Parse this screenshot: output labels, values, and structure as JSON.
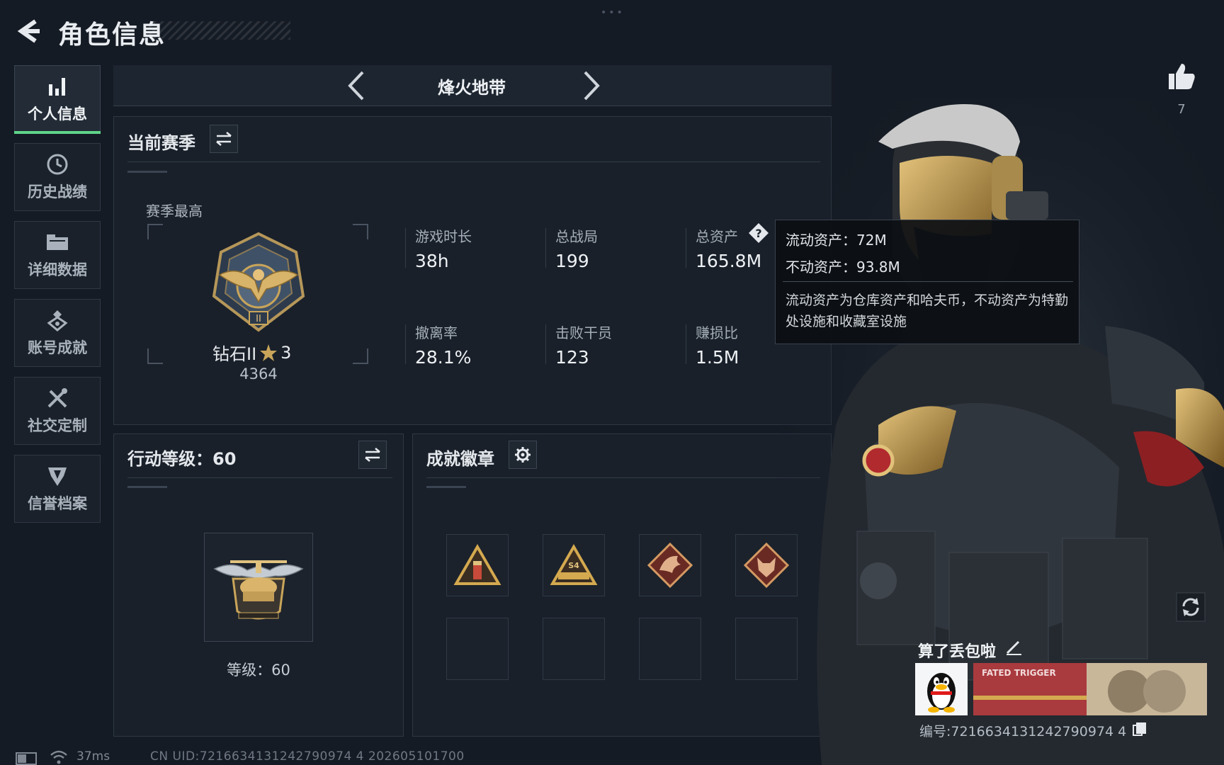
{
  "header": {
    "title": "角色信息",
    "dots": "•••"
  },
  "nav": {
    "items": [
      {
        "label": "个人信息",
        "icon": "bar-chart-icon",
        "active": true
      },
      {
        "label": "历史战绩",
        "icon": "clock-icon",
        "active": false
      },
      {
        "label": "详细数据",
        "icon": "folder-icon",
        "active": false
      },
      {
        "label": "账号成就",
        "icon": "medal-icon",
        "active": false
      },
      {
        "label": "社交定制",
        "icon": "tools-icon",
        "active": false
      },
      {
        "label": "信誉档案",
        "icon": "shield-icon",
        "active": false
      }
    ]
  },
  "mode": {
    "title": "烽火地带"
  },
  "season": {
    "title": "当前赛季",
    "best_label": "赛季最高",
    "rank_name": "钻石II",
    "rank_stars": "3",
    "rank_points": "4364",
    "stats": [
      {
        "label": "游戏时长",
        "value": "38h"
      },
      {
        "label": "总战局",
        "value": "199"
      },
      {
        "label": "总资产",
        "value": "165.8M"
      },
      {
        "label": "撤离率",
        "value": "28.1%"
      },
      {
        "label": "击败干员",
        "value": "123"
      },
      {
        "label": "赚损比",
        "value": "1.5M"
      }
    ]
  },
  "tooltip": {
    "liquid": "流动资产：72M",
    "fixed": "不动资产：93.8M",
    "note": "流动资产为仓库资产和哈夫币，不动资产为特勤处设施和收藏室设施"
  },
  "level": {
    "title": "行动等级：60",
    "level_text": "等级：60"
  },
  "badges": {
    "title": "成就徽章",
    "slots": [
      {
        "icon": "pyramid-badge-icon"
      },
      {
        "icon": "pyramid-s4-badge-icon"
      },
      {
        "icon": "dragon-badge-icon"
      },
      {
        "icon": "wolf-badge-icon"
      },
      {
        "icon": "empty"
      },
      {
        "icon": "empty"
      },
      {
        "icon": "empty"
      },
      {
        "icon": "empty"
      }
    ]
  },
  "profile": {
    "like_count": "7",
    "player_name": "算了丢包啦",
    "player_id": "编号:7216634131242790974 4",
    "card_text": "FATED TRIGGER"
  },
  "status": {
    "latency": "37ms",
    "uid_line": "CN UID:7216634131242790974 4 202605101700"
  },
  "colors": {
    "accent_green": "#5fd48a",
    "background": "#151b24",
    "panel": "#19202a",
    "gold": "#c9a55a",
    "card_red": "#a93a3e"
  }
}
